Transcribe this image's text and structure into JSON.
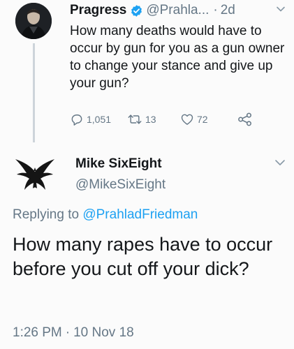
{
  "parent_tweet": {
    "display_name": "Pragress",
    "handle": "@Prahla...",
    "separator": "·",
    "time": "2d",
    "text": "How many deaths would have to occur by gun for you as a gun owner to change your stance and give up your gun?",
    "actions": {
      "reply_count": "1,051",
      "retweet_count": "13",
      "like_count": "72"
    }
  },
  "reply_tweet": {
    "display_name": "Mike SixEight",
    "handle": "@MikeSixEight",
    "replying_prefix": "Replying to",
    "replying_to": "@PrahladFriedman",
    "text": "How many rapes have to occur before you cut off your dick?",
    "time": "1:26 PM",
    "separator": "·",
    "date": "10 Nov 18"
  },
  "colors": {
    "text": "#14171a",
    "secondary": "#657786",
    "link": "#1da1f2",
    "verified": "#1da1f2",
    "thread_line": "#cdd4da"
  }
}
